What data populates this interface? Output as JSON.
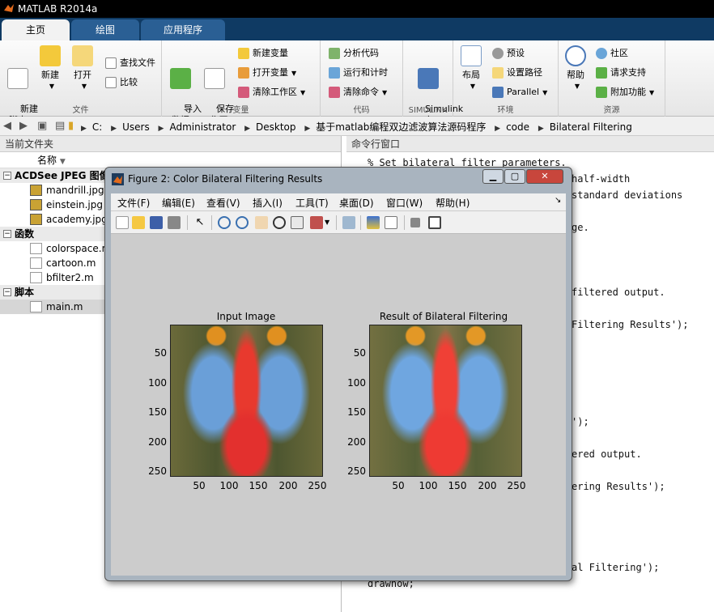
{
  "app": {
    "title": "MATLAB R2014a"
  },
  "tabs": [
    {
      "label": "主页"
    },
    {
      "label": "绘图"
    },
    {
      "label": "应用程序"
    }
  ],
  "ribbon": {
    "file_group": {
      "label": "文件",
      "new_script": "新建\n脚本",
      "new": "新建",
      "open": "打开",
      "find_files": "查找文件",
      "compare": "比较"
    },
    "variable_group": {
      "label": "变量",
      "import_data": "导入\n数据",
      "save_workspace": "保存\n工作区",
      "new_variable": "新建变量",
      "open_variable": "打开变量",
      "clear_workspace": "清除工作区"
    },
    "code_group": {
      "label": "代码",
      "analyze_code": "分析代码",
      "run_and_time": "运行和计时",
      "clear_commands": "清除命令"
    },
    "simulink_group": {
      "label": "SIMULINK",
      "library": "Simulink\n库"
    },
    "env_group": {
      "label": "环境",
      "layout": "布局",
      "preferences": "预设",
      "set_path": "设置路径",
      "parallel": "Parallel"
    },
    "resources_group": {
      "label": "资源",
      "help": "帮助",
      "community": "社区",
      "request_support": "请求支持",
      "addons": "附加功能"
    }
  },
  "address": {
    "crumbs": [
      "C:",
      "Users",
      "Administrator",
      "Desktop",
      "基于matlab编程双边滤波算法源码程序",
      "code",
      "Bilateral Filtering"
    ]
  },
  "left_panel": {
    "title": "当前文件夹",
    "column_name": "名称",
    "sections": [
      {
        "label": "ACDSee JPEG 图像",
        "files": [
          "mandrill.jpg",
          "einstein.jpg",
          "academy.jpg"
        ]
      },
      {
        "label": "函数",
        "files": [
          "colorspace.m",
          "cartoon.m",
          "bfilter2.m"
        ]
      },
      {
        "label": "脚本",
        "files": [
          "main.m"
        ]
      }
    ]
  },
  "command_window": {
    "title": "命令行窗口",
    "lines": [
      {
        "text": "% Set bilateral filter parameters."
      },
      {
        "text": "half-width"
      },
      {
        "text": "standard deviations"
      },
      {
        "text": "ge."
      },
      {
        "text": "filtered output."
      },
      {
        "text": "Filtering Results');"
      },
      {
        "text": "');"
      },
      {
        "text": "ered output."
      },
      {
        "text": "ering Results');"
      },
      {
        "text": "al Filtering');"
      },
      {
        "text": "drawnow;"
      }
    ]
  },
  "figure": {
    "title": "Figure 2: Color Bilateral Filtering Results",
    "menu": [
      "文件(F)",
      "编辑(E)",
      "查看(V)",
      "插入(I)",
      "工具(T)",
      "桌面(D)",
      "窗口(W)",
      "帮助(H)"
    ],
    "left_axes_title": "Input Image",
    "right_axes_title": "Result of Bilateral Filtering",
    "y_ticks": [
      "50",
      "100",
      "150",
      "200",
      "250"
    ],
    "x_ticks": [
      "50",
      "100",
      "150",
      "200",
      "250"
    ]
  }
}
